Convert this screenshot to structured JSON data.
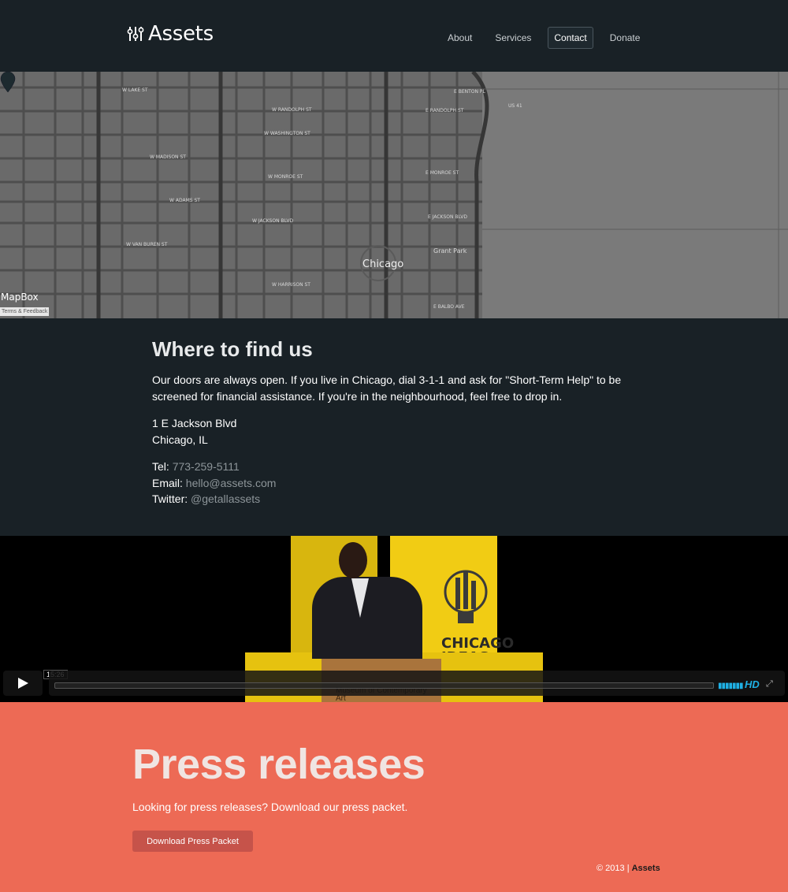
{
  "header": {
    "logo_text": "Assets",
    "nav": [
      {
        "label": "About",
        "active": false
      },
      {
        "label": "Services",
        "active": false
      },
      {
        "label": "Contact",
        "active": true
      },
      {
        "label": "Donate",
        "active": false
      }
    ]
  },
  "map": {
    "provider": "MapBox",
    "terms": "Terms & Feedback",
    "city_label": "Chicago",
    "labels": [
      "W LAKE ST",
      "W RANDOLPH ST",
      "W WASHINGTON ST",
      "W MADISON ST",
      "W MONROE ST",
      "W ADAMS ST",
      "W JACKSON BLVD",
      "W VAN BUREN ST",
      "W HARRISON ST",
      "E MONROE ST",
      "E RANDOLPH ST",
      "E BENTON PL",
      "E JACKSON BLVD",
      "E BALBO AVE",
      "US 41",
      "Grant Park"
    ]
  },
  "findus": {
    "title": "Where to find us",
    "intro": "Our doors are always open. If you live in Chicago, dial 3-1-1 and ask for \"Short-Term Help\" to be screened for financial assistance. If you're in the neighbourhood, feel free to drop in.",
    "address_line1": "1 E Jackson Blvd",
    "address_line2": "Chicago, IL",
    "tel_label": "Tel:",
    "tel_value": "773-259-5111",
    "email_label": "Email:",
    "email_value": "hello@assets.com",
    "twitter_label": "Twitter:",
    "twitter_value": "@getallassets"
  },
  "video": {
    "time": "15:26",
    "hd_label": "HD",
    "podium_text": "Museum of Contemporary Art",
    "banner_text": "CHICAGO IDEAS WEEK"
  },
  "press": {
    "title": "Press releases",
    "text": "Looking for press releases? Download our press packet.",
    "button": "Download Press Packet"
  },
  "footer": {
    "copyright": "© 2013 |",
    "brand": "Assets"
  }
}
